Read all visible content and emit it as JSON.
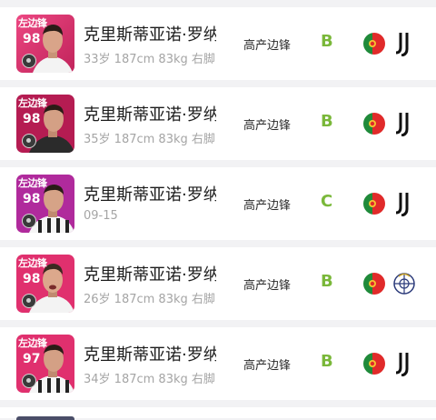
{
  "colors": {
    "card_pink": "#e0306e",
    "card_pink_dark": "#b51c52",
    "card_purple": "#b02a9c",
    "grade_green": "#7ab83a",
    "text_primary": "#1c1c1c",
    "text_secondary": "#a5a5a5"
  },
  "players": [
    {
      "position_tag": "左边锋",
      "rating": "98",
      "name": "克里斯蒂亚诺·罗纳尔多",
      "meta": "33岁 187cm 83kg 右脚",
      "position": "高产边锋",
      "grade": "B",
      "card_color": "#e0306e",
      "kit": "white",
      "nation_flag": "portugal-flag-icon",
      "club_icon": "juventus-icon"
    },
    {
      "position_tag": "左边锋",
      "rating": "98",
      "name": "克里斯蒂亚诺·罗纳尔多",
      "meta": "35岁 187cm 83kg 右脚",
      "position": "高产边锋",
      "grade": "B",
      "card_color": "#b51c52",
      "kit": "black",
      "nation_flag": "portugal-flag-icon",
      "club_icon": "juventus-icon"
    },
    {
      "position_tag": "左边锋",
      "rating": "98",
      "name": "克里斯蒂亚诺·罗纳尔多",
      "meta": "09-15",
      "position": "高产边锋",
      "grade": "C",
      "card_color": "#b02a9c",
      "kit": "stripes",
      "nation_flag": "portugal-flag-icon",
      "club_icon": "juventus-icon"
    },
    {
      "position_tag": "左边锋",
      "rating": "98",
      "name": "克里斯蒂亚诺·罗纳尔多",
      "meta": "26岁 187cm 83kg 右脚",
      "position": "高产边锋",
      "grade": "B",
      "card_color": "#e0306e",
      "kit": "white",
      "nation_flag": "portugal-flag-icon",
      "club_icon": "real-madrid-icon"
    },
    {
      "position_tag": "左边锋",
      "rating": "97",
      "name": "克里斯蒂亚诺·罗纳尔多",
      "meta": "34岁 187cm 83kg 右脚",
      "position": "高产边锋",
      "grade": "B",
      "card_color": "#e0306e",
      "kit": "stripes",
      "nation_flag": "portugal-flag-icon",
      "club_icon": "juventus-icon"
    }
  ]
}
